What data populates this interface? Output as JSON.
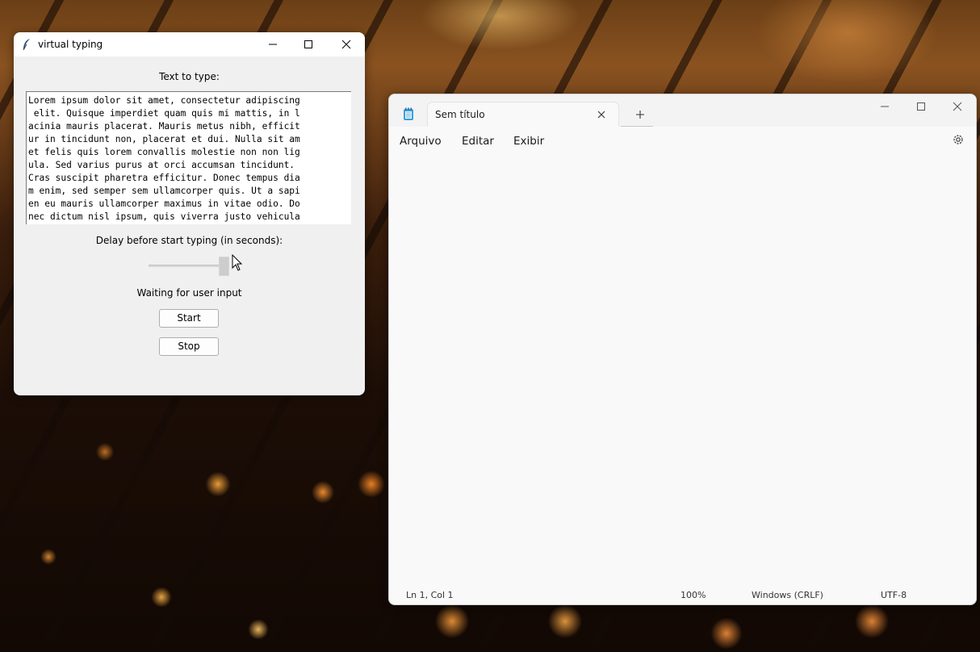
{
  "virtual_typing": {
    "title": "virtual typing",
    "text_label": "Text to type:",
    "text_lines": [
      "Lorem ipsum dolor sit amet, consectetur adipiscing",
      " elit. Quisque imperdiet quam quis mi mattis, in l",
      "acinia mauris placerat. Mauris metus nibh, efficit",
      "ur in tincidunt non, placerat et dui. Nulla sit am",
      "et felis quis lorem convallis molestie non non lig",
      "ula. Sed varius purus at orci accumsan tincidunt. ",
      "Cras suscipit pharetra efficitur. Donec tempus dia",
      "m enim, sed semper sem ullamcorper quis. Ut a sapi",
      "en eu mauris ullamcorper maximus in vitae odio. Do",
      "nec dictum nisl ipsum, quis viverra justo vehicula"
    ],
    "delay_label": "Delay before start typing (in seconds):",
    "status": "Waiting for user input",
    "start_label": "Start",
    "stop_label": "Stop"
  },
  "notepad": {
    "tab_title": "Sem título",
    "menu": [
      "Arquivo",
      "Editar",
      "Exibir"
    ],
    "status": {
      "position": "Ln 1, Col 1",
      "zoom": "100%",
      "line_ending": "Windows (CRLF)",
      "encoding": "UTF-8"
    }
  }
}
